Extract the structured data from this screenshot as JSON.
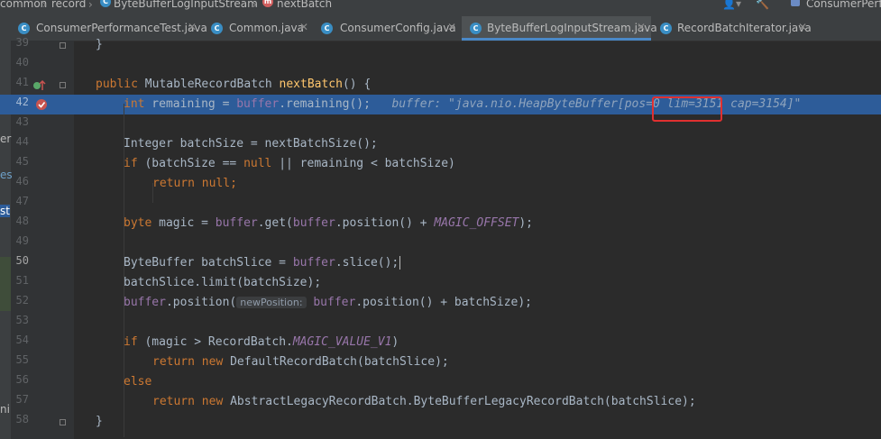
{
  "breadcrumbs": [
    "common",
    "record",
    "ByteBufferLogInputStream",
    "nextBatch"
  ],
  "top_right": "ConsumerPerfor",
  "tabs": [
    {
      "label": "ConsumerPerformanceTest.java",
      "active": false
    },
    {
      "label": "Common.java",
      "active": false
    },
    {
      "label": "ConsumerConfig.java",
      "active": false
    },
    {
      "label": "ByteBufferLogInputStream.java",
      "active": true
    },
    {
      "label": "RecordBatchIterator.java",
      "active": false
    }
  ],
  "side_labels": [
    "er",
    "es",
    "st",
    "ni"
  ],
  "line_numbers": [
    "39",
    "40",
    "41",
    "42",
    "43",
    "44",
    "45",
    "46",
    "47",
    "48",
    "49",
    "50",
    "51",
    "52",
    "53",
    "54",
    "55",
    "56",
    "57",
    "58"
  ],
  "code": {
    "l39": "}",
    "l41_kw1": "public",
    "l41_type": " MutableRecordBatch ",
    "l41_fn": "nextBatch",
    "l41_rest": "() {",
    "l42_kw": "int",
    "l42_a": " remaining = ",
    "l42_fld": "buffer",
    "l42_b": ".remaining();",
    "l42_inline": "buffer: \"java.nio.HeapByteBuffer[pos=0 lim=3151 cap=3154]\"",
    "l44_a": "Integer batchSize = nextBatchSize();",
    "l45_kw": "if",
    "l45_a": " (batchSize == ",
    "l45_kw2": "null",
    "l45_b": " || remaining < batchSize)",
    "l46_kw": "return",
    "l46_kw2": " null",
    "l46_b": ";",
    "l48_kw": "byte",
    "l48_a": " magic = ",
    "l48_fld": "buffer",
    "l48_b": ".get(",
    "l48_fld2": "buffer",
    "l48_c": ".position() + ",
    "l48_cst": "MAGIC_OFFSET",
    "l48_d": ");",
    "l50_a": "ByteBuffer batchSlice = ",
    "l50_fld": "buffer",
    "l50_b": ".slice();",
    "l51_a": "batchSlice.limit(batchSize);",
    "l52_fld": "buffer",
    "l52_a": ".position(",
    "l52_hint": "newPosition:",
    "l52_fld2": "buffer",
    "l52_b": ".position() + batchSize);",
    "l54_kw": "if",
    "l54_a": " (magic > RecordBatch.",
    "l54_cst": "MAGIC_VALUE_V1",
    "l54_b": ")",
    "l55_kw": "return",
    "l55_kw2": " new",
    "l55_a": " DefaultRecordBatch(batchSlice);",
    "l56_kw": "else",
    "l57_kw": "return",
    "l57_kw2": " new",
    "l57_a": " AbstractLegacyRecordBatch.ByteBufferLegacyRecordBatch(batchSlice);",
    "l58": "}"
  },
  "colors": {
    "accent": "#4a88c7",
    "highlight": "#2d5c99",
    "annotation": "#e03030"
  }
}
